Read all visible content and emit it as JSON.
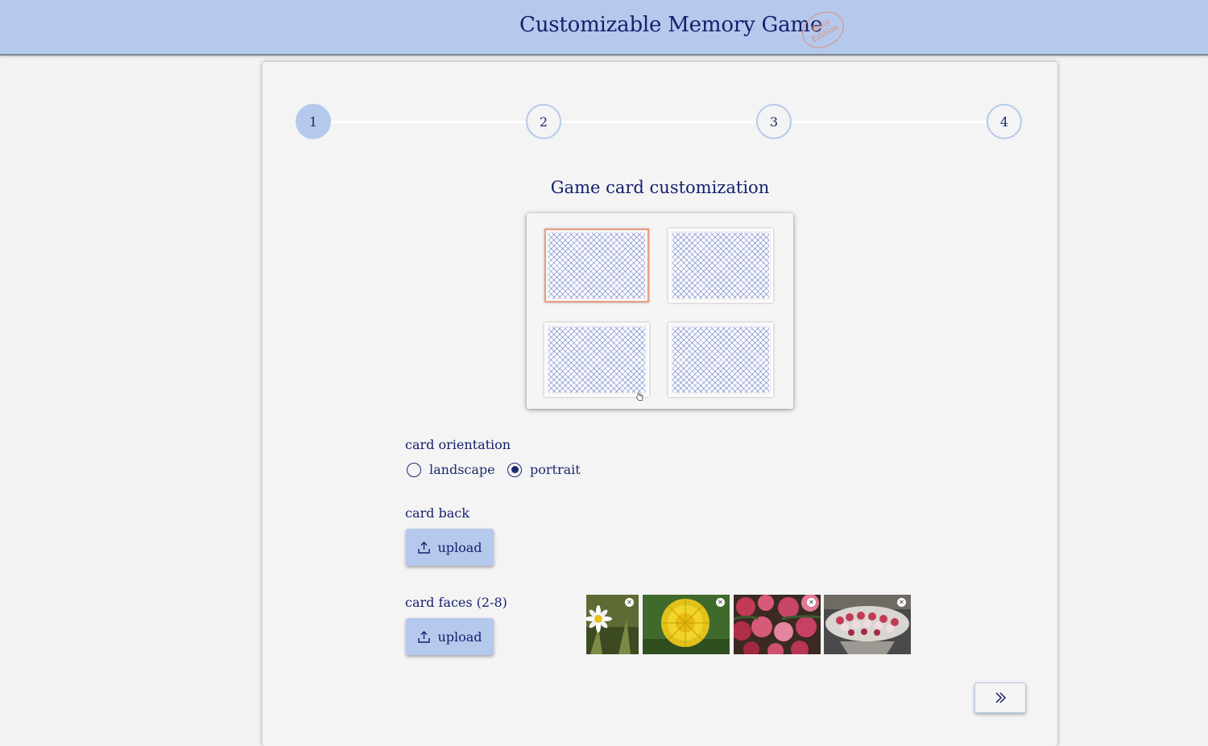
{
  "header": {
    "title": "Customizable Memory Game",
    "stamp_line1": "Bday",
    "stamp_line2": "Edition"
  },
  "stepper": {
    "steps": [
      "1",
      "2",
      "3",
      "4"
    ],
    "active_step": 1
  },
  "section": {
    "title": "Game card customization"
  },
  "orientation": {
    "label": "card orientation",
    "options": [
      "landscape",
      "portrait"
    ],
    "selected": "portrait"
  },
  "card_back": {
    "label": "card back",
    "button_label": "upload"
  },
  "card_faces": {
    "label": "card faces (2-8)",
    "button_label": "upload",
    "images": [
      "daisy",
      "dandelion",
      "red-pink-flowers",
      "flower-display"
    ]
  },
  "colors": {
    "header_bg": "#b5c9ec",
    "accent": "#b5c9ec",
    "text": "#14206e",
    "selected_card_border": "#e89c7e"
  }
}
